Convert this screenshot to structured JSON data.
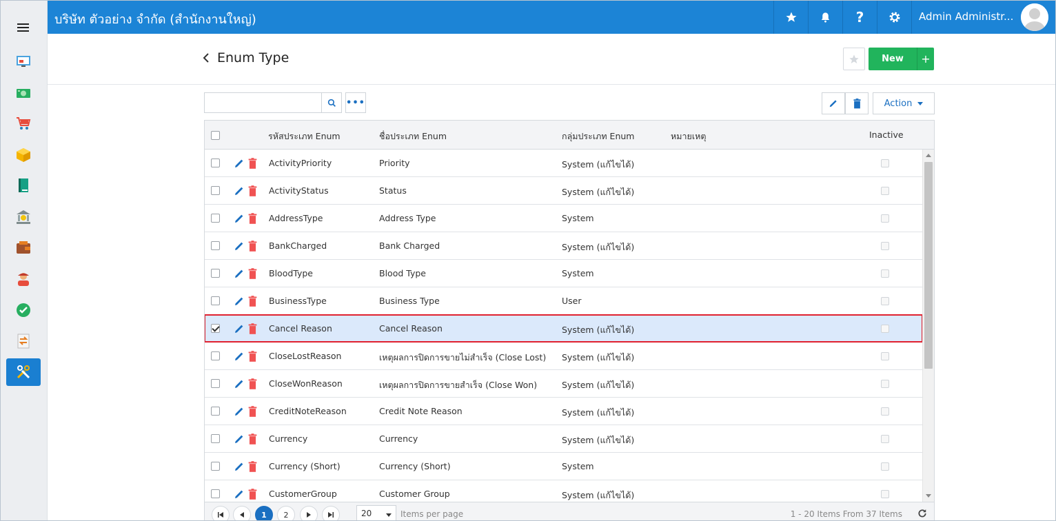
{
  "topbar": {
    "company": "บริษัท ตัวอย่าง จำกัด (สำนักงานใหญ่)",
    "user_name": "Admin Administr...",
    "icons": [
      "star-icon",
      "bell-icon",
      "help-icon",
      "gear-icon"
    ]
  },
  "sidebar": {
    "items": [
      {
        "icon": "dashboard-icon"
      },
      {
        "icon": "money-icon"
      },
      {
        "icon": "cart-icon"
      },
      {
        "icon": "box-icon"
      },
      {
        "icon": "book-icon"
      },
      {
        "icon": "bank-icon"
      },
      {
        "icon": "wallet-icon"
      },
      {
        "icon": "people-icon"
      },
      {
        "icon": "check-circle-icon"
      },
      {
        "icon": "transfer-icon"
      },
      {
        "icon": "tools-icon",
        "active": true
      }
    ]
  },
  "page": {
    "title": "Enum Type",
    "new_label": "New",
    "new_plus": "+"
  },
  "toolbar": {
    "search_value": "",
    "search_placeholder": "",
    "more_label": "•••",
    "action_label": "Action"
  },
  "grid": {
    "columns": {
      "code": "รหัสประเภท Enum",
      "name": "ชื่อประเภท Enum",
      "group": "กลุ่มประเภท Enum",
      "note": "หมายเหตุ",
      "inactive": "Inactive"
    },
    "rows": [
      {
        "code": "ActivityPriority",
        "name": "Priority",
        "group": "System (แก้ไขได้)",
        "selected": false
      },
      {
        "code": "ActivityStatus",
        "name": "Status",
        "group": "System (แก้ไขได้)",
        "selected": false
      },
      {
        "code": "AddressType",
        "name": "Address Type",
        "group": "System",
        "selected": false
      },
      {
        "code": "BankCharged",
        "name": "Bank Charged",
        "group": "System (แก้ไขได้)",
        "selected": false
      },
      {
        "code": "BloodType",
        "name": "Blood Type",
        "group": "System",
        "selected": false
      },
      {
        "code": "BusinessType",
        "name": "Business Type",
        "group": "User",
        "selected": false
      },
      {
        "code": "Cancel Reason",
        "name": "Cancel Reason",
        "group": "System (แก้ไขได้)",
        "selected": true
      },
      {
        "code": "CloseLostReason",
        "name": "เหตุผลการปิดการขายไม่สำเร็จ (Close Lost)",
        "group": "System (แก้ไขได้)",
        "selected": false
      },
      {
        "code": "CloseWonReason",
        "name": "เหตุผลการปิดการขายสำเร็จ (Close Won)",
        "group": "System (แก้ไขได้)",
        "selected": false
      },
      {
        "code": "CreditNoteReason",
        "name": "Credit Note Reason",
        "group": "System (แก้ไขได้)",
        "selected": false
      },
      {
        "code": "Currency",
        "name": "Currency",
        "group": "System (แก้ไขได้)",
        "selected": false
      },
      {
        "code": "Currency (Short)",
        "name": "Currency (Short)",
        "group": "System",
        "selected": false
      },
      {
        "code": "CustomerGroup",
        "name": "Customer Group",
        "group": "System (แก้ไขได้)",
        "selected": false
      }
    ]
  },
  "pager": {
    "pages": [
      "1",
      "2"
    ],
    "current_page": "1",
    "page_size": "20",
    "items_per_page": "Items per page",
    "info": "1 - 20 Items From 37 Items"
  },
  "colors": {
    "topbar": "#1c84d6",
    "new_button": "#21b45c",
    "selected_row": "#dbe9fb",
    "highlight_border": "#e0202e"
  }
}
